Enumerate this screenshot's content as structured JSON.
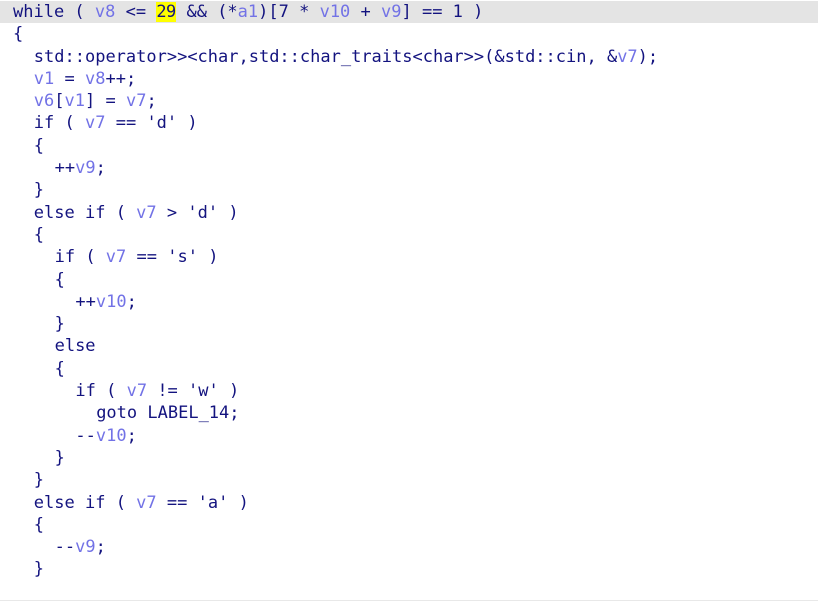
{
  "view": {
    "title": "pseudocode-decompiler-view",
    "background_color": "#ffffff",
    "current_line_background": "#e4e4e4",
    "highlight_color": "#ffff00",
    "keyword_color": "#13137f",
    "variable_color": "#7272e6",
    "caret_visible": true
  },
  "code": {
    "lines": [
      {
        "indent": 0,
        "current": true,
        "tokens": [
          {
            "t": "while",
            "c": "kw"
          },
          {
            "t": " ( ",
            "c": "punc"
          },
          {
            "t": "v8",
            "c": "var"
          },
          {
            "t": " <= ",
            "c": "punc"
          },
          {
            "t": "2",
            "c": "hl"
          },
          {
            "t": "CARET",
            "c": "caret"
          },
          {
            "t": "9",
            "c": "hl"
          },
          {
            "t": " && (*",
            "c": "punc"
          },
          {
            "t": "a1",
            "c": "var"
          },
          {
            "t": ")[7 * ",
            "c": "punc"
          },
          {
            "t": "v10",
            "c": "var"
          },
          {
            "t": " + ",
            "c": "punc"
          },
          {
            "t": "v9",
            "c": "var"
          },
          {
            "t": "] == 1 )",
            "c": "punc"
          }
        ]
      },
      {
        "indent": 0,
        "current": false,
        "tokens": [
          {
            "t": "{",
            "c": "punc"
          }
        ]
      },
      {
        "indent": 1,
        "current": false,
        "tokens": [
          {
            "t": "std::operator>><char,std::char_traits<char>>(&std::cin, &",
            "c": "typ"
          },
          {
            "t": "v7",
            "c": "var"
          },
          {
            "t": ");",
            "c": "punc"
          }
        ]
      },
      {
        "indent": 1,
        "current": false,
        "tokens": [
          {
            "t": "v1",
            "c": "var"
          },
          {
            "t": " = ",
            "c": "punc"
          },
          {
            "t": "v8",
            "c": "var"
          },
          {
            "t": "++;",
            "c": "punc"
          }
        ]
      },
      {
        "indent": 1,
        "current": false,
        "tokens": [
          {
            "t": "v6",
            "c": "var"
          },
          {
            "t": "[",
            "c": "punc"
          },
          {
            "t": "v1",
            "c": "var"
          },
          {
            "t": "] = ",
            "c": "punc"
          },
          {
            "t": "v7",
            "c": "var"
          },
          {
            "t": ";",
            "c": "punc"
          }
        ]
      },
      {
        "indent": 1,
        "current": false,
        "tokens": [
          {
            "t": "if",
            "c": "kw"
          },
          {
            "t": " ( ",
            "c": "punc"
          },
          {
            "t": "v7",
            "c": "var"
          },
          {
            "t": " == ",
            "c": "punc"
          },
          {
            "t": "'d'",
            "c": "lit"
          },
          {
            "t": " )",
            "c": "punc"
          }
        ]
      },
      {
        "indent": 1,
        "current": false,
        "tokens": [
          {
            "t": "{",
            "c": "punc"
          }
        ]
      },
      {
        "indent": 2,
        "current": false,
        "tokens": [
          {
            "t": "++",
            "c": "punc"
          },
          {
            "t": "v9",
            "c": "var"
          },
          {
            "t": ";",
            "c": "punc"
          }
        ]
      },
      {
        "indent": 1,
        "current": false,
        "tokens": [
          {
            "t": "}",
            "c": "punc"
          }
        ]
      },
      {
        "indent": 1,
        "current": false,
        "tokens": [
          {
            "t": "else if",
            "c": "kw"
          },
          {
            "t": " ( ",
            "c": "punc"
          },
          {
            "t": "v7",
            "c": "var"
          },
          {
            "t": " > ",
            "c": "punc"
          },
          {
            "t": "'d'",
            "c": "lit"
          },
          {
            "t": " )",
            "c": "punc"
          }
        ]
      },
      {
        "indent": 1,
        "current": false,
        "tokens": [
          {
            "t": "{",
            "c": "punc"
          }
        ]
      },
      {
        "indent": 2,
        "current": false,
        "tokens": [
          {
            "t": "if",
            "c": "kw"
          },
          {
            "t": " ( ",
            "c": "punc"
          },
          {
            "t": "v7",
            "c": "var"
          },
          {
            "t": " == ",
            "c": "punc"
          },
          {
            "t": "'s'",
            "c": "lit"
          },
          {
            "t": " )",
            "c": "punc"
          }
        ]
      },
      {
        "indent": 2,
        "current": false,
        "tokens": [
          {
            "t": "{",
            "c": "punc"
          }
        ]
      },
      {
        "indent": 3,
        "current": false,
        "tokens": [
          {
            "t": "++",
            "c": "punc"
          },
          {
            "t": "v10",
            "c": "var"
          },
          {
            "t": ";",
            "c": "punc"
          }
        ]
      },
      {
        "indent": 2,
        "current": false,
        "tokens": [
          {
            "t": "}",
            "c": "punc"
          }
        ]
      },
      {
        "indent": 2,
        "current": false,
        "tokens": [
          {
            "t": "else",
            "c": "kw"
          }
        ]
      },
      {
        "indent": 2,
        "current": false,
        "tokens": [
          {
            "t": "{",
            "c": "punc"
          }
        ]
      },
      {
        "indent": 3,
        "current": false,
        "tokens": [
          {
            "t": "if",
            "c": "kw"
          },
          {
            "t": " ( ",
            "c": "punc"
          },
          {
            "t": "v7",
            "c": "var"
          },
          {
            "t": " != ",
            "c": "punc"
          },
          {
            "t": "'w'",
            "c": "lit"
          },
          {
            "t": " )",
            "c": "punc"
          }
        ]
      },
      {
        "indent": 4,
        "current": false,
        "tokens": [
          {
            "t": "goto",
            "c": "kw"
          },
          {
            "t": " ",
            "c": "punc"
          },
          {
            "t": "LABEL_14",
            "c": "lbl"
          },
          {
            "t": ";",
            "c": "punc"
          }
        ]
      },
      {
        "indent": 3,
        "current": false,
        "tokens": [
          {
            "t": "--",
            "c": "punc"
          },
          {
            "t": "v10",
            "c": "var"
          },
          {
            "t": ";",
            "c": "punc"
          }
        ]
      },
      {
        "indent": 2,
        "current": false,
        "tokens": [
          {
            "t": "}",
            "c": "punc"
          }
        ]
      },
      {
        "indent": 1,
        "current": false,
        "tokens": [
          {
            "t": "}",
            "c": "punc"
          }
        ]
      },
      {
        "indent": 1,
        "current": false,
        "tokens": [
          {
            "t": "else if",
            "c": "kw"
          },
          {
            "t": " ( ",
            "c": "punc"
          },
          {
            "t": "v7",
            "c": "var"
          },
          {
            "t": " == ",
            "c": "punc"
          },
          {
            "t": "'a'",
            "c": "lit"
          },
          {
            "t": " )",
            "c": "punc"
          }
        ]
      },
      {
        "indent": 1,
        "current": false,
        "tokens": [
          {
            "t": "{",
            "c": "punc"
          }
        ]
      },
      {
        "indent": 2,
        "current": false,
        "tokens": [
          {
            "t": "--",
            "c": "punc"
          },
          {
            "t": "v9",
            "c": "var"
          },
          {
            "t": ";",
            "c": "punc"
          }
        ]
      },
      {
        "indent": 1,
        "current": false,
        "tokens": [
          {
            "t": "}",
            "c": "punc"
          }
        ]
      }
    ]
  }
}
